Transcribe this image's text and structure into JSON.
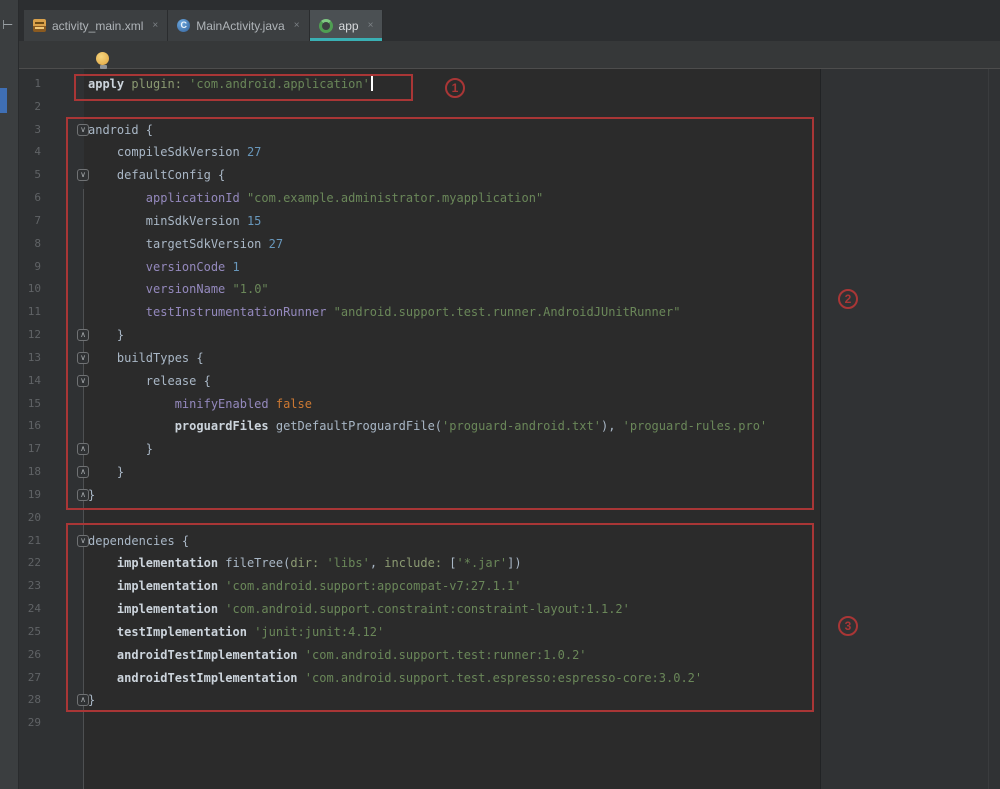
{
  "window": {
    "app": "Android Studio editor",
    "file_kind": "gradle build script"
  },
  "stripe": {
    "toggle_glyph": "⊢"
  },
  "tabs": [
    {
      "label": "activity_main.xml",
      "icon": "layout-xml-file-icon",
      "close": "×",
      "selected": false
    },
    {
      "label": "MainActivity.java",
      "icon": "java-class-icon",
      "glyph": "C",
      "close": "×",
      "selected": false
    },
    {
      "label": "app",
      "icon": "gradle-icon",
      "close": "×",
      "selected": true,
      "underline_color": "#3ab0b4"
    }
  ],
  "colors": {
    "editor_bg": "#2b2b2b",
    "gutter_bg": "#2f3133",
    "tab_bar_bg": "#3c3f41",
    "selected_tab_bg": "#4b5053",
    "annotation_red": "#a93636",
    "string_green": "#6a8759",
    "number_blue": "#6897bb",
    "keyword_orange": "#cc7832",
    "property_purple": "#9489bd",
    "plain_text": "#a9b7c6",
    "line_number": "#606366",
    "active_tab_underline": "#3ab0b4"
  },
  "annotations": {
    "badges": [
      "1",
      "2",
      "3"
    ]
  },
  "editor": {
    "lines": [
      {
        "n": "1",
        "caret": true,
        "segs": [
          [
            "m",
            "apply"
          ],
          [
            "p",
            " "
          ],
          [
            "na",
            "plugin:"
          ],
          [
            "p",
            " "
          ],
          [
            "s",
            "'com.android.application'"
          ]
        ]
      },
      {
        "n": "2",
        "segs": []
      },
      {
        "n": "3",
        "fold": "start",
        "segs": [
          [
            "p",
            "android {"
          ]
        ]
      },
      {
        "n": "4",
        "segs": [
          [
            "p",
            "    compileSdkVersion "
          ],
          [
            "n",
            "27"
          ]
        ]
      },
      {
        "n": "5",
        "fold": "start",
        "segs": [
          [
            "p",
            "    defaultConfig {"
          ]
        ]
      },
      {
        "n": "6",
        "segs": [
          [
            "p",
            "        "
          ],
          [
            "d",
            "applicationId"
          ],
          [
            "p",
            " "
          ],
          [
            "s",
            "\"com.example.administrator.myapplication\""
          ]
        ]
      },
      {
        "n": "7",
        "segs": [
          [
            "p",
            "        minSdkVersion "
          ],
          [
            "n",
            "15"
          ]
        ]
      },
      {
        "n": "8",
        "segs": [
          [
            "p",
            "        targetSdkVersion "
          ],
          [
            "n",
            "27"
          ]
        ]
      },
      {
        "n": "9",
        "segs": [
          [
            "p",
            "        "
          ],
          [
            "d",
            "versionCode"
          ],
          [
            "p",
            " "
          ],
          [
            "n",
            "1"
          ]
        ]
      },
      {
        "n": "10",
        "segs": [
          [
            "p",
            "        "
          ],
          [
            "d",
            "versionName"
          ],
          [
            "p",
            " "
          ],
          [
            "s",
            "\"1.0\""
          ]
        ]
      },
      {
        "n": "11",
        "segs": [
          [
            "p",
            "        "
          ],
          [
            "d",
            "testInstrumentationRunner"
          ],
          [
            "p",
            " "
          ],
          [
            "s",
            "\"android.support.test.runner.AndroidJUnitRunner\""
          ]
        ]
      },
      {
        "n": "12",
        "fold": "end",
        "segs": [
          [
            "p",
            "    }"
          ]
        ]
      },
      {
        "n": "13",
        "fold": "start",
        "segs": [
          [
            "p",
            "    buildTypes {"
          ]
        ]
      },
      {
        "n": "14",
        "fold": "start",
        "segs": [
          [
            "p",
            "        release {"
          ]
        ]
      },
      {
        "n": "15",
        "segs": [
          [
            "p",
            "            "
          ],
          [
            "d",
            "minifyEnabled"
          ],
          [
            "p",
            " "
          ],
          [
            "kw",
            "false"
          ]
        ]
      },
      {
        "n": "16",
        "segs": [
          [
            "p",
            "            "
          ],
          [
            "m",
            "proguardFiles"
          ],
          [
            "p",
            " getDefaultProguardFile("
          ],
          [
            "s",
            "'proguard-android.txt'"
          ],
          [
            "p",
            "), "
          ],
          [
            "s",
            "'proguard-rules.pro'"
          ]
        ]
      },
      {
        "n": "17",
        "fold": "end",
        "segs": [
          [
            "p",
            "        }"
          ]
        ]
      },
      {
        "n": "18",
        "fold": "end",
        "segs": [
          [
            "p",
            "    }"
          ]
        ]
      },
      {
        "n": "19",
        "fold": "end",
        "segs": [
          [
            "p",
            "}"
          ]
        ]
      },
      {
        "n": "20",
        "segs": []
      },
      {
        "n": "21",
        "fold": "start",
        "segs": [
          [
            "p",
            "dependencies {"
          ]
        ]
      },
      {
        "n": "22",
        "segs": [
          [
            "p",
            "    "
          ],
          [
            "m",
            "implementation"
          ],
          [
            "p",
            " fileTree("
          ],
          [
            "na",
            "dir:"
          ],
          [
            "p",
            " "
          ],
          [
            "s",
            "'libs'"
          ],
          [
            "p",
            ", "
          ],
          [
            "na",
            "include:"
          ],
          [
            "p",
            " ["
          ],
          [
            "s",
            "'*.jar'"
          ],
          [
            "p",
            "])"
          ]
        ]
      },
      {
        "n": "23",
        "segs": [
          [
            "p",
            "    "
          ],
          [
            "m",
            "implementation"
          ],
          [
            "p",
            " "
          ],
          [
            "s",
            "'com.android.support:appcompat-v7:27.1.1'"
          ]
        ]
      },
      {
        "n": "24",
        "segs": [
          [
            "p",
            "    "
          ],
          [
            "m",
            "implementation"
          ],
          [
            "p",
            " "
          ],
          [
            "s",
            "'com.android.support.constraint:constraint-layout:1.1.2'"
          ]
        ]
      },
      {
        "n": "25",
        "segs": [
          [
            "p",
            "    "
          ],
          [
            "m",
            "testImplementation"
          ],
          [
            "p",
            " "
          ],
          [
            "s",
            "'junit:junit:4.12'"
          ]
        ]
      },
      {
        "n": "26",
        "segs": [
          [
            "p",
            "    "
          ],
          [
            "m",
            "androidTestImplementation"
          ],
          [
            "p",
            " "
          ],
          [
            "s",
            "'com.android.support.test:runner:1.0.2'"
          ]
        ]
      },
      {
        "n": "27",
        "segs": [
          [
            "p",
            "    "
          ],
          [
            "m",
            "androidTestImplementation"
          ],
          [
            "p",
            " "
          ],
          [
            "s",
            "'com.android.support.test.espresso:espresso-core:3.0.2'"
          ]
        ]
      },
      {
        "n": "28",
        "fold": "end",
        "segs": [
          [
            "p",
            "}"
          ]
        ]
      },
      {
        "n": "29",
        "segs": []
      }
    ]
  }
}
